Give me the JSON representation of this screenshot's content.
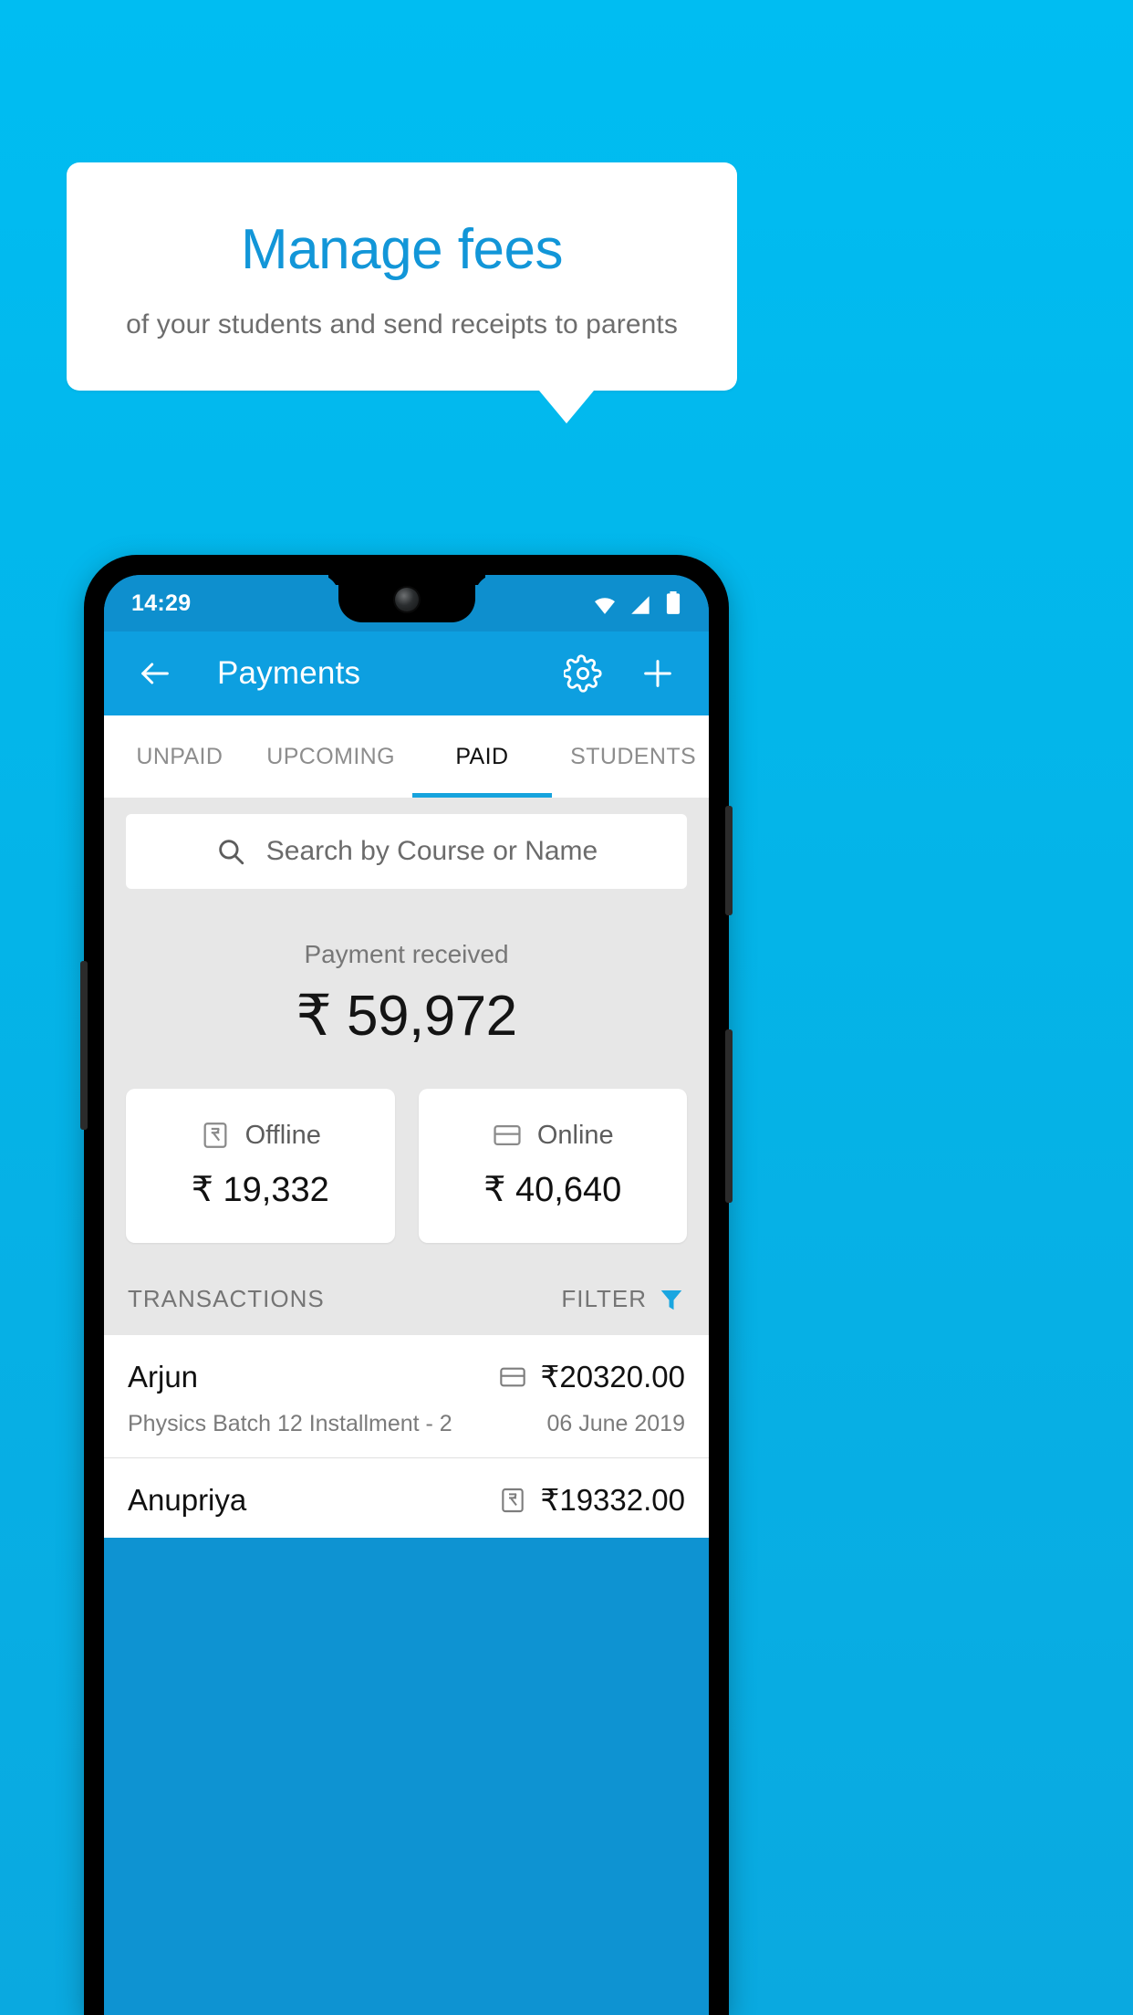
{
  "promo": {
    "title": "Manage fees",
    "subtitle": "of your students and send receipts to parents",
    "background_color": "#06b6ea",
    "title_color": "#1296d8",
    "card_color": "#ffffff"
  },
  "phone": {
    "status_bar": {
      "time": "14:29",
      "wifi_icon": "wifi-icon",
      "signal_icon": "signal-icon",
      "battery_icon": "battery-icon",
      "background_color": "#0e8fce"
    },
    "app_bar": {
      "back_icon": "back-arrow-icon",
      "title": "Payments",
      "settings_icon": "gear-icon",
      "add_icon": "plus-icon",
      "background_color": "#0d9fe0"
    },
    "tabs": [
      {
        "label": "UNPAID",
        "active": false
      },
      {
        "label": "UPCOMING",
        "active": false
      },
      {
        "label": "PAID",
        "active": true
      },
      {
        "label": "STUDENTS",
        "active": false
      }
    ],
    "tab_indicator_color": "#17a3dd",
    "search": {
      "placeholder": "Search by Course or Name",
      "icon": "search-icon"
    },
    "summary": {
      "label": "Payment received",
      "amount": "₹ 59,972"
    },
    "payment_cards": [
      {
        "label": "Offline",
        "amount": "₹ 19,332",
        "icon": "cash-note-icon"
      },
      {
        "label": "Online",
        "amount": "₹ 40,640",
        "icon": "credit-card-icon"
      }
    ],
    "transactions_header": {
      "title": "TRANSACTIONS",
      "filter_label": "FILTER",
      "filter_icon": "funnel-icon",
      "filter_icon_color": "#1aa6e0"
    },
    "transactions": [
      {
        "name": "Arjun",
        "amount": "₹20320.00",
        "method_icon": "credit-card-icon",
        "description": "Physics Batch 12 Installment - 2",
        "date": "06 June 2019"
      },
      {
        "name": "Anupriya",
        "amount": "₹19332.00",
        "method_icon": "cash-note-icon",
        "description": "",
        "date": ""
      }
    ]
  }
}
